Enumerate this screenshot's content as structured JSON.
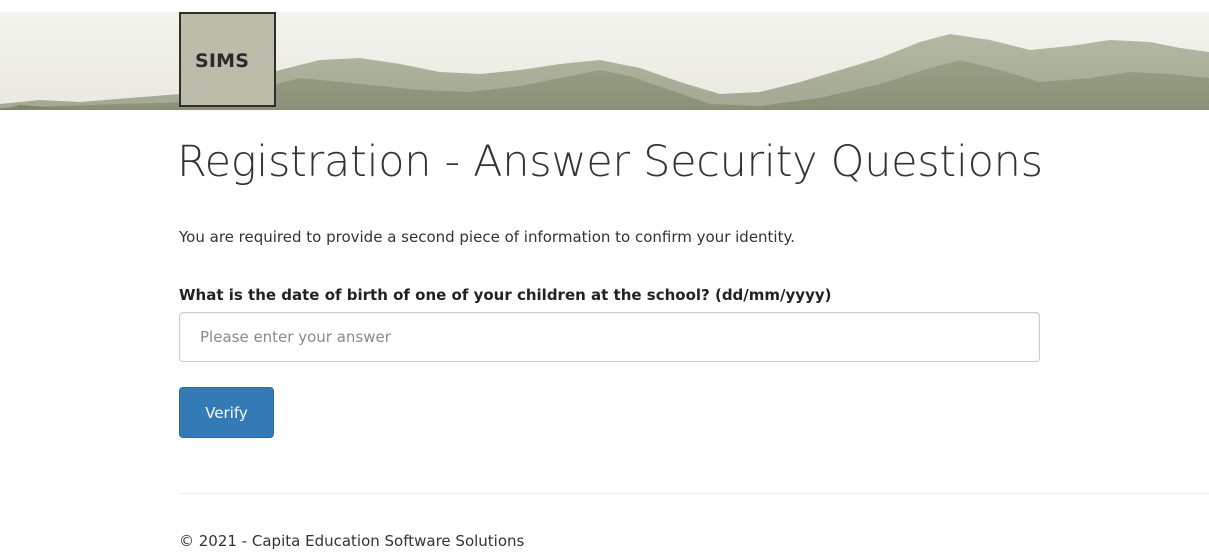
{
  "header": {
    "logo_text": "SIMS"
  },
  "main": {
    "title": "Registration - Answer Security Questions",
    "intro": "You are required to provide a second piece of information to confirm your identity.",
    "question_label": "What is the date of birth of one of your children at the school? (dd/mm/yyyy)",
    "answer_value": "",
    "answer_placeholder": "Please enter your answer",
    "verify_label": "Verify"
  },
  "footer": {
    "copyright": "© 2021 - Capita Education Software Solutions"
  },
  "colors": {
    "primary_button": "#337ab7",
    "banner_sky": "#f1f1ec",
    "banner_hills": "#9ea48c",
    "logo_background": "#bdbcaa"
  }
}
